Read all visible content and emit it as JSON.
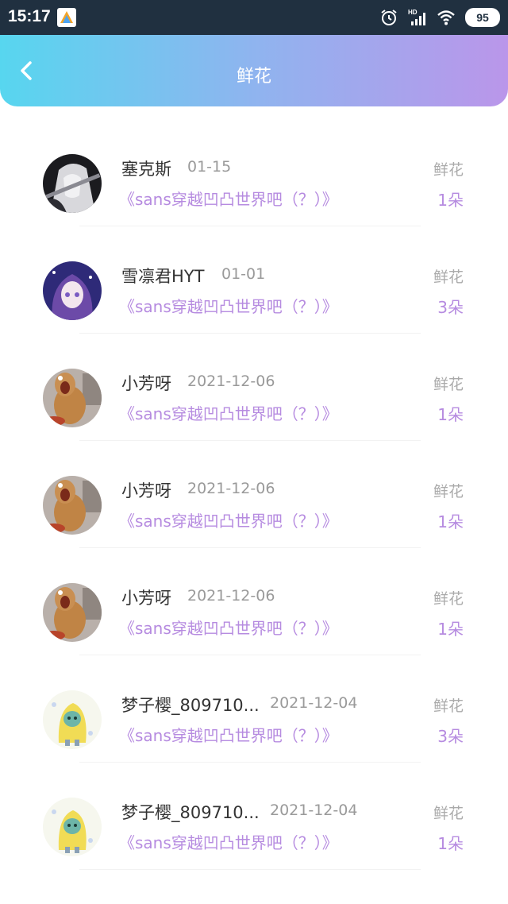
{
  "status_bar": {
    "time": "15:17",
    "network": "HD",
    "battery": "95",
    "icons": [
      "app-icon",
      "alarm-icon",
      "signal-icon",
      "wifi-icon",
      "battery-icon"
    ]
  },
  "header": {
    "title": "鲜花",
    "back_icon": "chevron-left-icon",
    "gradient": [
      "#57d6ef",
      "#8fb4ef",
      "#ba96ea"
    ]
  },
  "colors": {
    "accent": "#b68be0",
    "name": "#333333",
    "secondary": "#9a9a9a"
  },
  "items": [
    {
      "name": "塞克斯",
      "date": "01-15",
      "work": "《sans穿越凹凸世界吧（？）》",
      "gift_label": "鲜花",
      "count": "1朵",
      "avatar": "dark-anime-avatar"
    },
    {
      "name": "雪凛君HYT",
      "date": "01-01",
      "work": "《sans穿越凹凸世界吧（？）》",
      "gift_label": "鲜花",
      "count": "3朵",
      "avatar": "purple-anime-avatar"
    },
    {
      "name": "小芳呀",
      "date": "2021-12-06",
      "work": "《sans穿越凹凸世界吧（？）》",
      "gift_label": "鲜花",
      "count": "1朵",
      "avatar": "cartoon-mouse-avatar"
    },
    {
      "name": "小芳呀",
      "date": "2021-12-06",
      "work": "《sans穿越凹凸世界吧（？）》",
      "gift_label": "鲜花",
      "count": "1朵",
      "avatar": "cartoon-mouse-avatar"
    },
    {
      "name": "小芳呀",
      "date": "2021-12-06",
      "work": "《sans穿越凹凸世界吧（？）》",
      "gift_label": "鲜花",
      "count": "1朵",
      "avatar": "cartoon-mouse-avatar"
    },
    {
      "name": "梦子樱_809710...",
      "date": "2021-12-04",
      "work": "《sans穿越凹凸世界吧（？）》",
      "gift_label": "鲜花",
      "count": "3朵",
      "avatar": "yellow-raincoat-avatar"
    },
    {
      "name": "梦子樱_809710...",
      "date": "2021-12-04",
      "work": "《sans穿越凹凸世界吧（？）》",
      "gift_label": "鲜花",
      "count": "1朵",
      "avatar": "yellow-raincoat-avatar"
    }
  ]
}
